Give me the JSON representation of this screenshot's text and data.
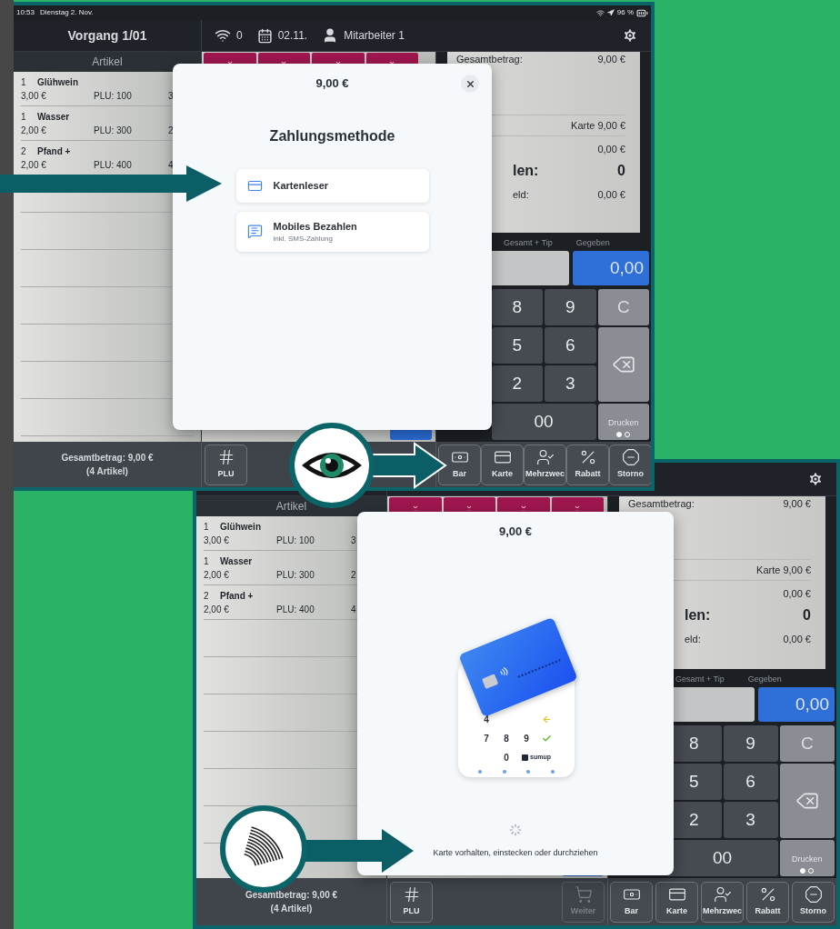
{
  "screens": [
    {
      "status_bar": {
        "time": "10:53",
        "date": "Dienstag 2. Nov.",
        "battery": "96 %"
      },
      "header": {
        "title": "Vorgang 1/01",
        "wifi": "0",
        "date": "02.11.",
        "user": "Mitarbeiter 1"
      },
      "articles": {
        "heading": "Artikel",
        "items": [
          {
            "qty": "1",
            "name": "Glühwein",
            "price": "3,00 €",
            "plu": "PLU: 100",
            "column_3": "3"
          },
          {
            "qty": "1",
            "name": "Wasser",
            "price": "2,00 €",
            "plu": "PLU: 300",
            "column_3": "2"
          },
          {
            "qty": "2",
            "name": "Pfand +",
            "price": "2,00 €",
            "plu": "PLU: 400",
            "column_3": "4"
          }
        ]
      },
      "total": {
        "line1": "Gesamtbetrag: 9,00 €",
        "line2": "(4 Artikel)"
      },
      "receipt": {
        "total_label": "Gesamtbetrag:",
        "total_value": "9,00 €",
        "payment": "Karte 9,00 €",
        "value_1": "0,00 €",
        "due_label": "len:",
        "due_value": "0",
        "change_label": "eld:",
        "change_value": "0,00 €"
      },
      "entry": {
        "tip_label": "Gesamt + Tip",
        "given_label": "Gegeben",
        "given_value": "0,00"
      },
      "keypad": [
        {
          "kind": "digit",
          "label": "8"
        },
        {
          "kind": "digit",
          "label": "9"
        },
        {
          "kind": "clear",
          "label": "C"
        },
        {
          "kind": "digit",
          "label": "5"
        },
        {
          "kind": "digit",
          "label": "6"
        },
        {
          "kind": "backspace"
        },
        {
          "kind": "digit",
          "label": "2"
        },
        {
          "kind": "digit",
          "label": "3"
        },
        {
          "kind": "digit",
          "label": "00"
        },
        {
          "kind": "print",
          "label": "Drucken",
          "pages": [
            {
              "selected": true
            },
            {
              "selected": false
            }
          ]
        }
      ],
      "toolbar": {
        "left": [
          {
            "kind": "hash",
            "label": "PLU",
            "disabled": false
          }
        ],
        "actions": [
          {
            "kind": "cash",
            "label": "Bar"
          },
          {
            "kind": "card",
            "label": "Karte"
          },
          {
            "kind": "split",
            "label": "Mehrzwec"
          },
          {
            "kind": "percent",
            "label": "Rabatt"
          },
          {
            "kind": "cancel",
            "label": "Storno"
          }
        ]
      },
      "dialog": {
        "kind": "methods",
        "amount": "9,00 €",
        "title": "Zahlungsmethode",
        "options": [
          {
            "kind": "reader",
            "label": "Kartenleser"
          },
          {
            "kind": "mobile",
            "label": "Mobiles Bezahlen",
            "sublabel": "inkl. SMS-Zahlung"
          }
        ]
      }
    },
    {
      "articles": {
        "heading": "Artikel",
        "items": [
          {
            "qty": "1",
            "name": "Glühwein",
            "price": "3,00 €",
            "plu": "PLU: 100",
            "column_3": "3"
          },
          {
            "qty": "1",
            "name": "Wasser",
            "price": "2,00 €",
            "plu": "PLU: 300",
            "column_3": "2"
          },
          {
            "qty": "2",
            "name": "Pfand +",
            "price": "2,00 €",
            "plu": "PLU: 400",
            "column_3": "4"
          }
        ]
      },
      "total": {
        "line1": "Gesamtbetrag: 9,00 €",
        "line2": "(4 Artikel)"
      },
      "receipt": {
        "total_label": "Gesamtbetrag:",
        "total_value": "9,00 €",
        "payment": "Karte 9,00 €",
        "value_1": "0,00 €",
        "due_label": "len:",
        "due_value": "0",
        "change_label": "eld:",
        "change_value": "0,00 €"
      },
      "entry": {
        "tip_label": "Gesamt + Tip",
        "given_label": "Gegeben",
        "given_value": "0,00"
      },
      "keypad": [
        {
          "kind": "digit",
          "label": "8"
        },
        {
          "kind": "digit",
          "label": "9"
        },
        {
          "kind": "clear",
          "label": "C"
        },
        {
          "kind": "digit",
          "label": "5"
        },
        {
          "kind": "digit",
          "label": "6"
        },
        {
          "kind": "backspace"
        },
        {
          "kind": "digit",
          "label": "2"
        },
        {
          "kind": "digit",
          "label": "3"
        },
        {
          "kind": "digit",
          "label": "00"
        },
        {
          "kind": "print",
          "label": "Drucken",
          "pages": [
            {
              "selected": true
            },
            {
              "selected": false
            }
          ]
        }
      ],
      "toolbar": {
        "left": [
          {
            "kind": "hash",
            "label": "PLU",
            "disabled": false
          },
          {
            "kind": "cart",
            "label": "Weiter",
            "disabled": true
          }
        ],
        "actions": [
          {
            "kind": "cash",
            "label": "Bar"
          },
          {
            "kind": "card",
            "label": "Karte"
          },
          {
            "kind": "split",
            "label": "Mehrzwec"
          },
          {
            "kind": "percent",
            "label": "Rabatt"
          },
          {
            "kind": "cancel",
            "label": "Storno"
          }
        ]
      },
      "dialog": {
        "kind": "reader",
        "amount": "9,00 €",
        "reader_keys": [
          {
            "kind": "digit",
            "label": "4"
          },
          {
            "kind": "blank"
          },
          {
            "kind": "blank"
          },
          {
            "kind": "back"
          },
          {
            "kind": "digit",
            "label": "7"
          },
          {
            "kind": "digit",
            "label": "8"
          },
          {
            "kind": "digit",
            "label": "9"
          },
          {
            "kind": "ok"
          },
          {
            "kind": "blank"
          },
          {
            "kind": "digit",
            "label": "0"
          }
        ],
        "brand": "sumup",
        "message": "Karte vorhalten, einstecken oder durchziehen"
      }
    }
  ]
}
